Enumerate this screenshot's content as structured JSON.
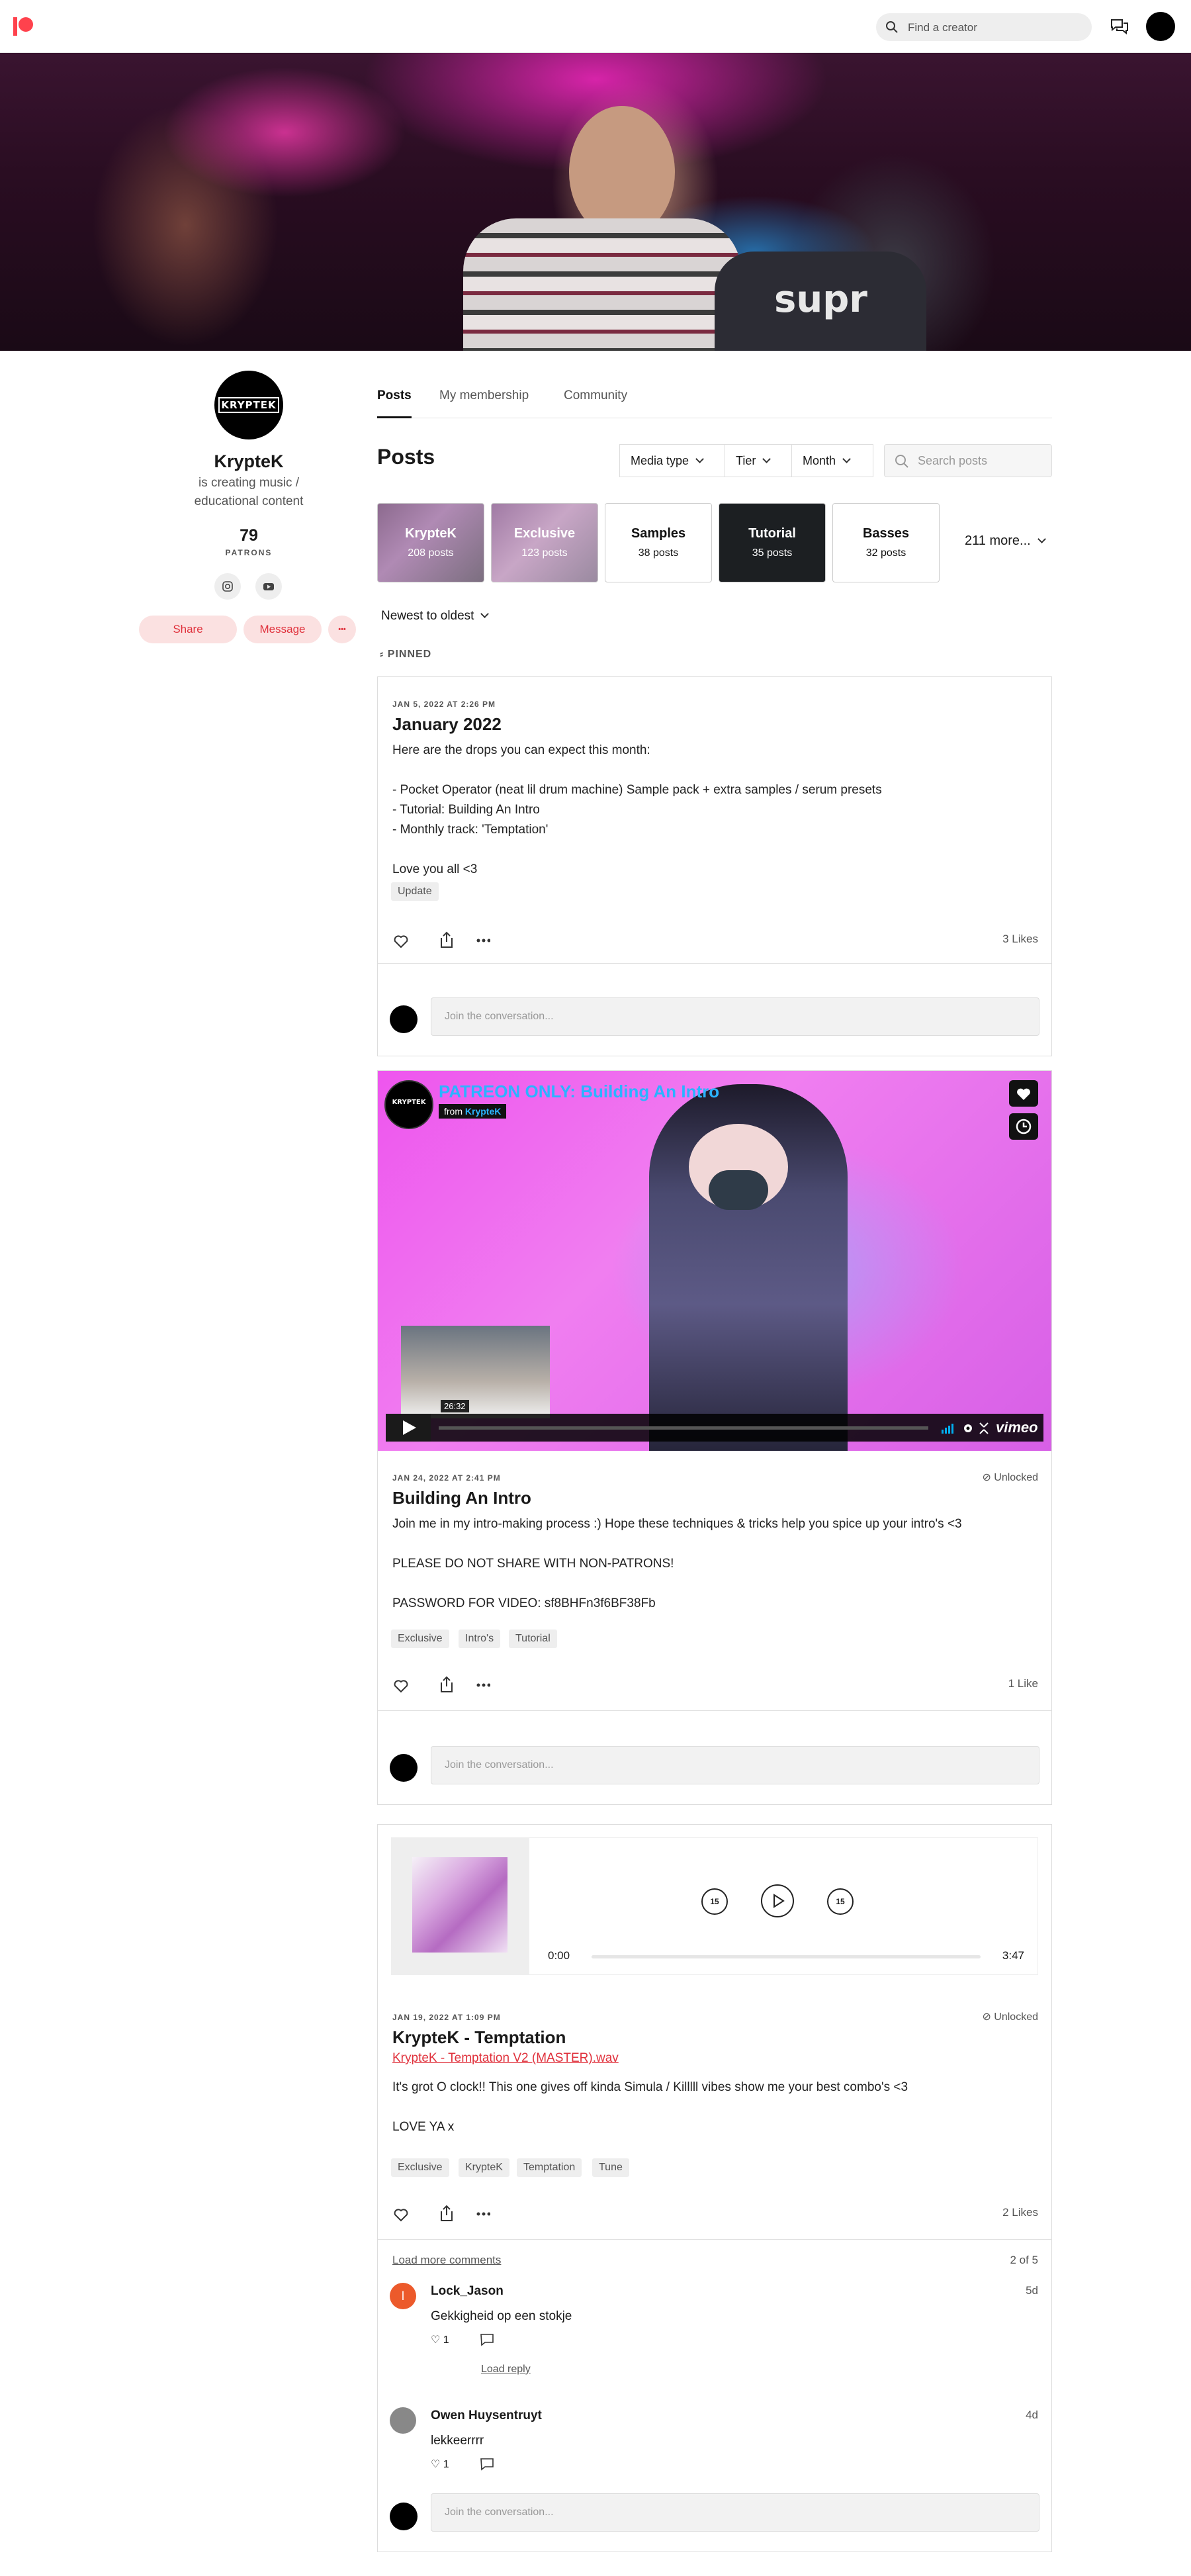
{
  "nav": {
    "search_placeholder": "Find a creator"
  },
  "profile": {
    "logo_text": "KRYPTEK",
    "name": "KrypteK",
    "description_1": "is creating music /",
    "description_2": "educational content",
    "patron_count": "79",
    "patron_label": "PATRONS",
    "share_label": "Share",
    "message_label": "Message",
    "more_label": "•••"
  },
  "tabs": [
    "Posts",
    "My membership",
    "Community"
  ],
  "posts_heading": "Posts",
  "filters": {
    "media_type": "Media type",
    "tier": "Tier",
    "month": "Month",
    "search_placeholder": "Search posts"
  },
  "collections": [
    {
      "title": "KrypteK",
      "count": "208 posts"
    },
    {
      "title": "Exclusive",
      "count": "123 posts"
    },
    {
      "title": "Samples",
      "count": "38 posts"
    },
    {
      "title": "Tutorial",
      "count": "35 posts"
    },
    {
      "title": "Basses",
      "count": "32 posts"
    }
  ],
  "more_collections": "211 more...",
  "sort_label": "Newest to oldest",
  "pinned_label": "PINNED",
  "post1": {
    "date": "JAN 5, 2022 AT 2:26 PM",
    "title": "January 2022",
    "line1": "Here are the drops you can expect this month:",
    "line2": "- Pocket Operator (neat lil drum machine) Sample pack + extra samples / serum presets",
    "line3": "- Tutorial: Building An Intro",
    "line4": "- Monthly track: 'Temptation'",
    "line5": "Love you all <3",
    "tags": [
      "Update"
    ],
    "likes": "3 Likes",
    "comment_placeholder": "Join the conversation..."
  },
  "post2": {
    "video_title": "PATREON ONLY: Building An Intro",
    "video_from": "from",
    "video_author": "KrypteK",
    "video_duration": "26:32",
    "video_brand": "vimeo",
    "unlocked": "Unlocked",
    "date": "JAN 24, 2022 AT 2:41 PM",
    "title": "Building An Intro",
    "line1": "Join me in my intro-making process :) Hope these techniques & tricks help you spice up your intro's <3",
    "line2": "PLEASE DO NOT SHARE WITH NON-PATRONS!",
    "line3": "PASSWORD FOR VIDEO: sf8BHFn3f6BF38Fb",
    "tags": [
      "Exclusive",
      "Intro's",
      "Tutorial"
    ],
    "likes": "1 Like",
    "comment_placeholder": "Join the conversation..."
  },
  "post3": {
    "audio_start": "0:00",
    "audio_end": "3:47",
    "skip_back": "15",
    "skip_fwd": "15",
    "unlocked": "Unlocked",
    "date": "JAN 19, 2022 AT 1:09 PM",
    "title": "KrypteK - Temptation",
    "file_link": "KrypteK - Temptation V2 (MASTER).wav",
    "line1": "It's grot O clock!! This one gives off kinda Simula / Killlll vibes show me your best combo's <3",
    "line2": "LOVE YA x",
    "tags": [
      "Exclusive",
      "KrypteK",
      "Temptation",
      "Tune"
    ],
    "likes": "2 Likes",
    "load_more": "Load more comments",
    "comment_count": "2 of 5",
    "comments": [
      {
        "initial": "l",
        "name": "Lock_Jason",
        "time": "5d",
        "text": "Gekkigheid op een stokje",
        "likes": "1",
        "reply": "Load reply"
      },
      {
        "name": "Owen Huysentruyt",
        "time": "4d",
        "text": "lekkeerrrr",
        "likes": "1"
      }
    ],
    "comment_placeholder": "Join the conversation..."
  }
}
